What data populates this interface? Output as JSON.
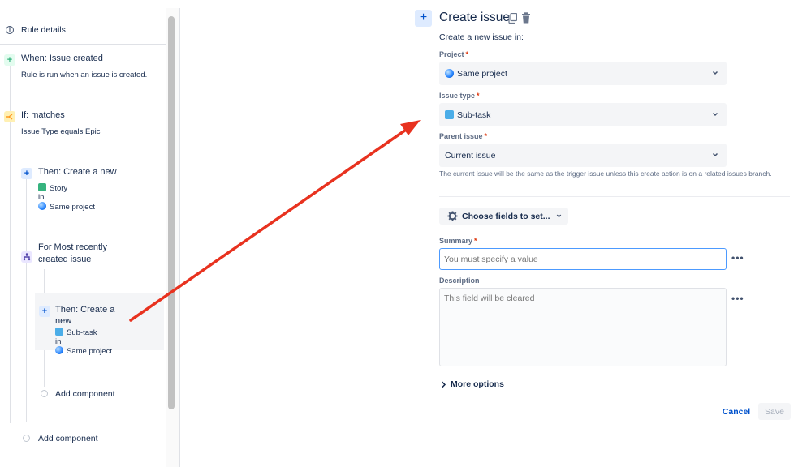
{
  "sidebar": {
    "rule_details_label": "Rule details",
    "trigger": {
      "title": "When: Issue created",
      "subtitle": "Rule is run when an issue is created."
    },
    "condition": {
      "title": "If: matches",
      "subtitle": "Issue Type equals Epic"
    },
    "action1": {
      "title": "Then: Create a new",
      "issue_type": "Story",
      "in_label": "in",
      "project": "Same project"
    },
    "branch": {
      "title_line1": "For Most recently",
      "title_line2": "created issue"
    },
    "action2": {
      "title_line1": "Then: Create a",
      "title_line2": "new",
      "issue_type": "Sub-task",
      "in_label": "in",
      "project": "Same project"
    },
    "add_component_inner": "Add component",
    "add_component_outer": "Add component"
  },
  "panel": {
    "title": "Create issue",
    "subtitle": "Create a new issue in:",
    "project": {
      "label": "Project",
      "value": "Same project"
    },
    "issue_type": {
      "label": "Issue type",
      "value": "Sub-task"
    },
    "parent_issue": {
      "label": "Parent issue",
      "value": "Current issue",
      "helper": "The current issue will be the same as the trigger issue unless this create action is on a related issues branch."
    },
    "choose_fields": "Choose fields to set...",
    "summary": {
      "label": "Summary",
      "placeholder": "You must specify a value"
    },
    "description": {
      "label": "Description",
      "placeholder": "This field will be cleared"
    },
    "more_options": "More options",
    "cancel": "Cancel",
    "save": "Save",
    "required_mark": "*",
    "more_dots": "•••"
  },
  "colors": {
    "accent": "#0052cc",
    "arrow": "#e8321f",
    "selected_bg": "#f4f5f7",
    "required": "#de350b"
  }
}
